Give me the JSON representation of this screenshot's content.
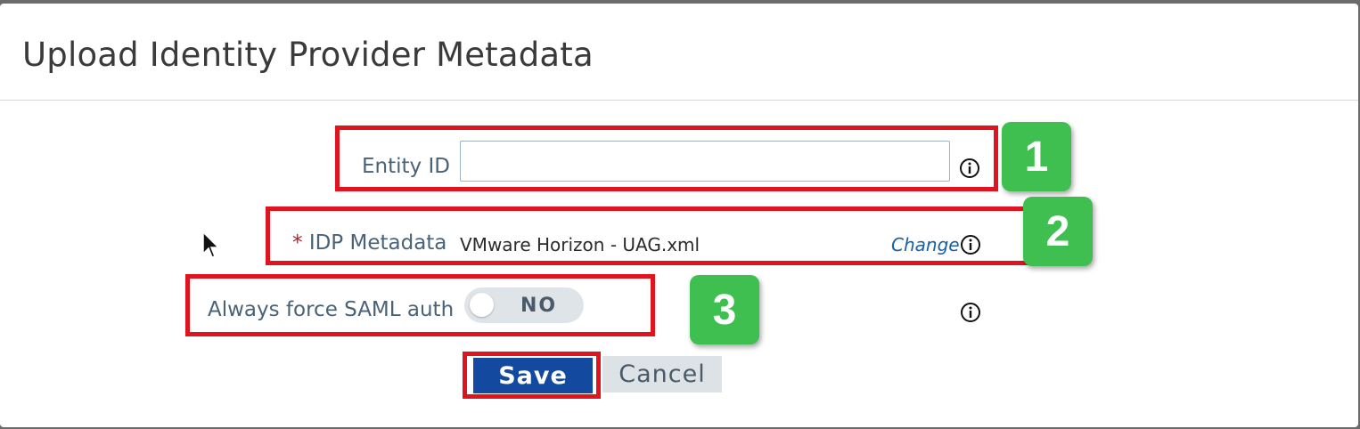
{
  "dialog": {
    "title": "Upload Identity Provider Metadata"
  },
  "form": {
    "entity_id": {
      "label": "Entity ID",
      "value": "",
      "placeholder": ""
    },
    "idp_metadata": {
      "required_marker": "*",
      "label": "IDP Metadata",
      "file_name": "VMware Horizon - UAG.xml",
      "change_label": "Change"
    },
    "force_saml": {
      "label": "Always force SAML auth",
      "toggle_state": "NO"
    }
  },
  "buttons": {
    "save_label": "Save",
    "cancel_label": "Cancel"
  },
  "annotations": {
    "badges": [
      "1",
      "2",
      "3"
    ],
    "highlight_color": "#e0141e",
    "badge_color": "#3fbf50"
  },
  "colors": {
    "save_button": "#134a9f",
    "label_text": "#4a6278",
    "link": "#1a5fa8"
  },
  "icons": [
    "info-icon",
    "mouse-cursor-icon"
  ]
}
